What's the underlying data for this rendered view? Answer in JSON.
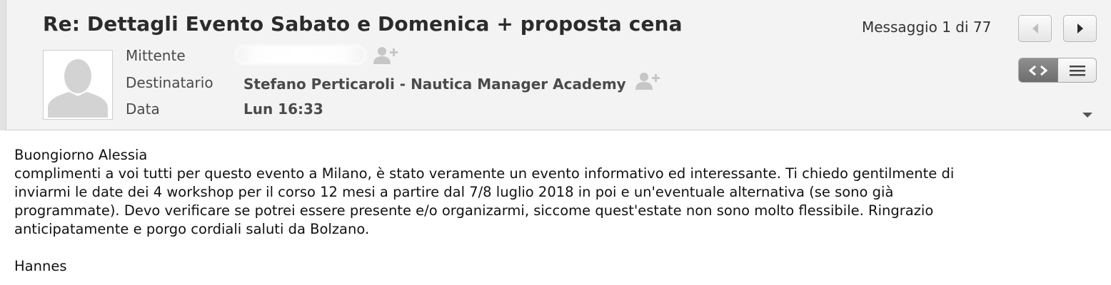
{
  "message": {
    "subject": "Re: Dettagli Evento Sabato e Domenica + proposta cena",
    "counter": "Messaggio 1 di 77",
    "fields": {
      "from_label": "Mittente",
      "to_label": "Destinatario",
      "to_value": "Stefano Perticaroli - Nautica Manager Academy",
      "date_label": "Data",
      "date_value": "Lun 16:33"
    }
  },
  "body": {
    "greeting": "Buongiorno Alessia",
    "lines": [
      "complimenti a voi tutti per questo evento a Milano, è stato veramente un evento informativo ed interessante. Ti chiedo gentilmente di",
      "inviarmi le date dei 4 workshop per il corso 12 mesi a partire dal 7/8 luglio 2018 in poi e un'eventuale alternativa (se sono già",
      "programmate). Devo verificare se potrei essere presente e/o organizarmi, siccome quest'estate non sono molto flessibile. Ringrazio",
      "anticipatamente e porgo cordiali saluti da Bolzano."
    ],
    "signature": "Hannes"
  },
  "icons": {
    "avatar": "person-placeholder-icon",
    "add_contact": "add-contact-icon",
    "prev": "triangle-left-icon",
    "next": "triangle-right-icon",
    "view_source": "code-brackets-icon",
    "view_plain": "lines-icon",
    "expand": "chevron-down-icon"
  },
  "colors": {
    "header_bg": "#f3f3f3",
    "text": "#4a4a4a",
    "segment_active": "#7a7a7a"
  }
}
